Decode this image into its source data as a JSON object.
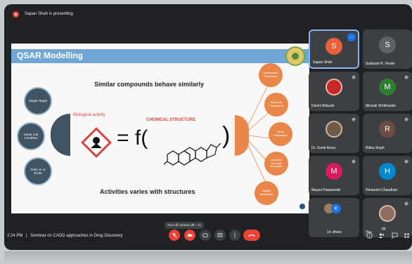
{
  "meeting": {
    "presenting_text": "Sapan Shah is presenting",
    "time": "2:24 PM",
    "separator": "|",
    "title": "Seminar on CADD approaches in Drug Discovery",
    "tooltip": "Turn off camera (⌘ + e)"
  },
  "slide": {
    "title": "QSAR Modelling",
    "heading_top": "Similar compounds behave similarly",
    "heading_bottom": "Activities varies with structures",
    "bio_label": "Biological activity",
    "chem_label": "CHEMICAL STRUCTURE",
    "equation": "= f(",
    "paren_close": ")",
    "left_nodes": [
      "Single Target",
      "Same Lab Condition",
      "IC50, Ki or EC50"
    ],
    "right_nodes": [
      "Hydrophobic Parameters",
      "Electronic Parameters",
      "Steric Parameters",
      "Quantum chemical descriptors",
      "Spatial descriptors"
    ]
  },
  "participants": [
    {
      "name": "Sapan Shah",
      "initial": "S",
      "color": "#e8603c",
      "type": "letter"
    },
    {
      "name": "Subhash R. Yende",
      "initial": "S",
      "color": "#5f6368",
      "type": "letter"
    },
    {
      "name": "Davini Bobade",
      "initial": "",
      "color": "#c62828",
      "type": "photo"
    },
    {
      "name": "Mrunali Shrikhande",
      "initial": "M",
      "color": "#2e7d32",
      "type": "letter"
    },
    {
      "name": "Dr. Sumit Arora",
      "initial": "",
      "color": "#6d5a48",
      "type": "photo"
    },
    {
      "name": "Ritika Singh",
      "initial": "R",
      "color": "#6d4c41",
      "type": "letter"
    },
    {
      "name": "Mayuri Palasmode",
      "initial": "M",
      "color": "#d81b60",
      "type": "letter"
    },
    {
      "name": "Himanshi Chaudhari",
      "initial": "H",
      "color": "#0288d1",
      "type": "letter"
    },
    {
      "name": "14 others",
      "initial": "K",
      "color": "#1a73e8",
      "type": "group"
    },
    {
      "name": "You",
      "initial": "",
      "color": "#8d6e63",
      "type": "photo"
    }
  ],
  "people_count": "26",
  "icons": [
    "present-icon",
    "mic-off-icon",
    "camera-off-icon",
    "captions-icon",
    "present-now-icon",
    "more-icon",
    "end-call-icon",
    "info-icon",
    "people-icon",
    "chat-icon",
    "activities-icon"
  ]
}
